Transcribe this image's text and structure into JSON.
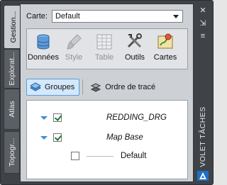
{
  "side_tabs": [
    "Gestion...",
    "Explorat...",
    "Atlas",
    "Topogr..."
  ],
  "map_selector": {
    "label": "Carte:",
    "value": "Default"
  },
  "toolbar": [
    {
      "id": "data",
      "label": "Données",
      "icon": "database-icon",
      "enabled": true
    },
    {
      "id": "style",
      "label": "Style",
      "icon": "style-brush-icon",
      "enabled": false
    },
    {
      "id": "table",
      "label": "Table",
      "icon": "table-icon",
      "enabled": false
    },
    {
      "id": "tools",
      "label": "Outils",
      "icon": "tools-icon",
      "enabled": true
    },
    {
      "id": "maps",
      "label": "Cartes",
      "icon": "map-icon",
      "enabled": true
    }
  ],
  "view_tabs": {
    "groups": "Groupes",
    "draw_order": "Ordre de tracé",
    "active": "groups"
  },
  "layers": [
    {
      "name": "REDDING_DRG",
      "checked": true,
      "expanded": true
    },
    {
      "name": "Map Base",
      "checked": true,
      "expanded": true
    },
    {
      "name": "Default",
      "checked": false
    }
  ],
  "palette_title": "VOLET TÂCHES",
  "colors": {
    "frame": "#3f4347",
    "panel": "#cdd0d4",
    "selected_tab": "#d4e8fb",
    "check": "#1e7a2e",
    "caret": "#3a8fd8"
  }
}
